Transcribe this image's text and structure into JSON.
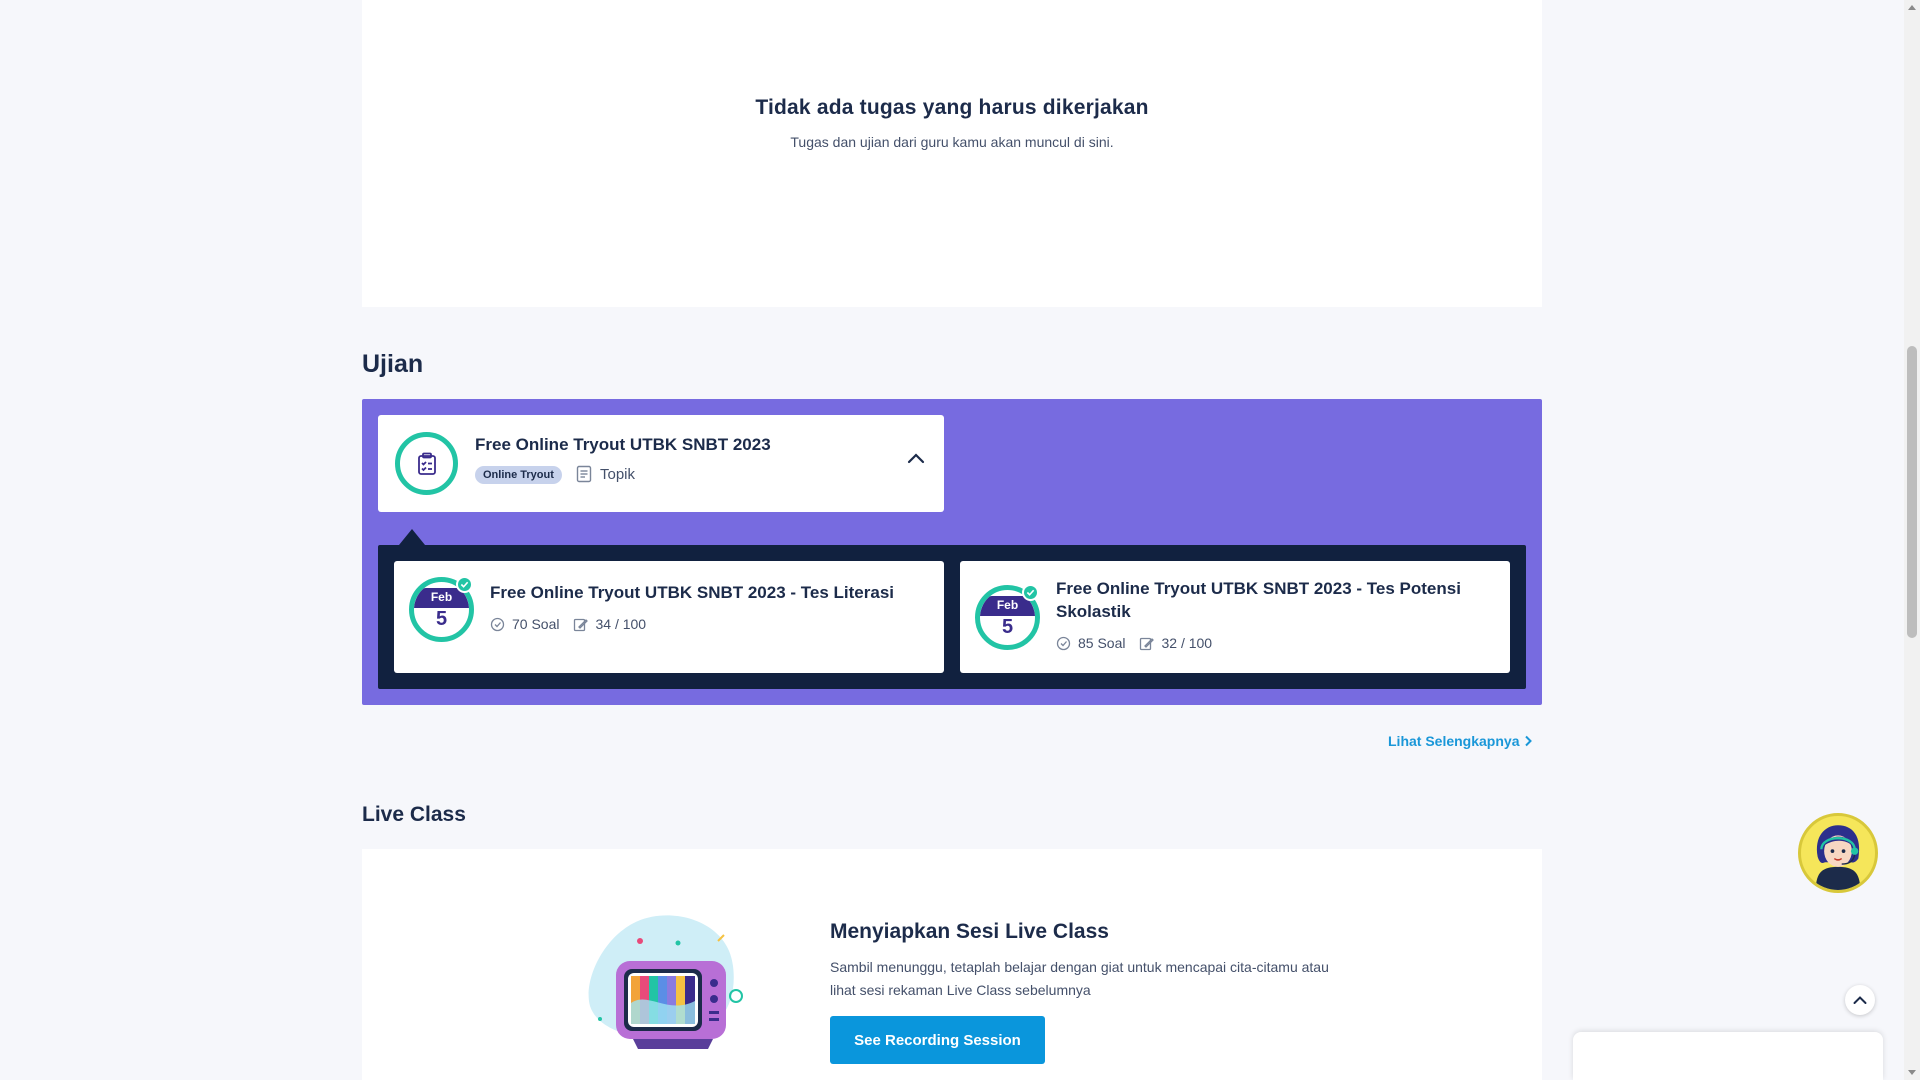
{
  "tasks": {
    "empty_title": "Tidak ada tugas yang harus dikerjakan",
    "empty_subtitle": "Tugas dan ujian dari guru kamu akan muncul di sini."
  },
  "ujian": {
    "section_title": "Ujian",
    "group": {
      "title": "Free Online Tryout UTBK SNBT 2023",
      "badge": "Online Tryout",
      "topic_label": "Topik"
    },
    "items": [
      {
        "title": "Free Online Tryout UTBK SNBT 2023 - Tes Literasi",
        "month": "Feb",
        "day": "5",
        "questions": "70 Soal",
        "score": "34 / 100"
      },
      {
        "title": "Free Online Tryout UTBK SNBT 2023 - Tes Potensi Skolastik",
        "month": "Feb",
        "day": "5",
        "questions": "85 Soal",
        "score": "32 / 100"
      }
    ],
    "see_more": "Lihat Selengkapnya"
  },
  "live_class": {
    "section_title": "Live Class",
    "heading": "Menyiapkan Sesi Live Class",
    "description": "Sambil menunggu, tetaplah belajar dengan giat untuk mencapai cita-citamu atau lihat sesi rekaman Live Class sebelumnya",
    "button_label": "See Recording Session"
  },
  "colors": {
    "accent_purple": "#776be0",
    "dark_navy": "#11213f",
    "teal": "#22c4a5",
    "link_blue": "#1a97d8",
    "button_blue": "#0a96dc"
  }
}
